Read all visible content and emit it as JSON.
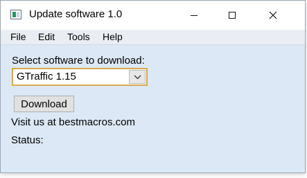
{
  "window": {
    "title": "Update software 1.0",
    "controls": {
      "minimize": "minimize",
      "maximize": "maximize",
      "close": "close"
    }
  },
  "menubar": {
    "items": [
      "File",
      "Edit",
      "Tools",
      "Help"
    ]
  },
  "main": {
    "select_label": "Select software to download:",
    "software_select": {
      "selected": "GTraffic 1.15"
    },
    "download_label": "Download",
    "visit_text": "Visit us at bestmacros.com",
    "status_label": "Status:"
  },
  "colors": {
    "client_background": "#dce8f5",
    "menubar_background": "#eaeef4",
    "combo_focus_border": "#d8a84a"
  },
  "icons": {
    "app": "app-window-icon",
    "minimize": "minimize-icon",
    "maximize": "maximize-icon",
    "close": "close-icon",
    "dropdown": "chevron-down-icon"
  }
}
